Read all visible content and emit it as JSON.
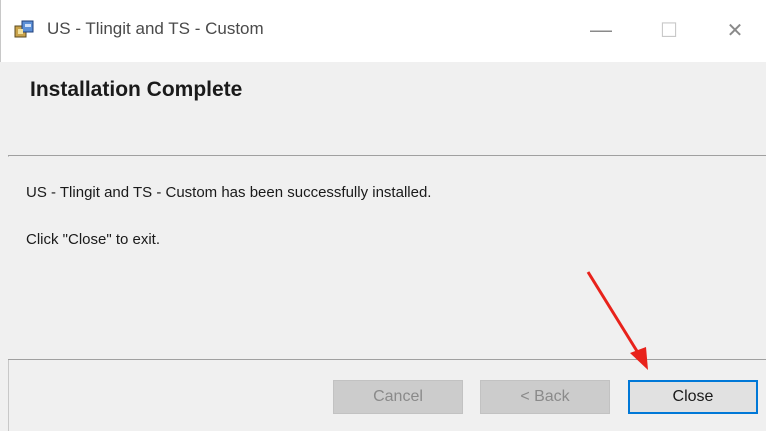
{
  "window": {
    "title": "US - Tlingit and TS - Custom",
    "controls": {
      "minimize": "—",
      "maximize": "☐",
      "close": "✕"
    }
  },
  "header": {
    "title": "Installation Complete"
  },
  "body": {
    "message": "US - Tlingit and TS - Custom has been successfully installed.",
    "instruction": "Click \"Close\" to exit."
  },
  "buttons": {
    "cancel": "Cancel",
    "back": "< Back",
    "close": "Close"
  },
  "colors": {
    "focus_border": "#0078d7",
    "annotation_arrow": "#e8221b"
  }
}
